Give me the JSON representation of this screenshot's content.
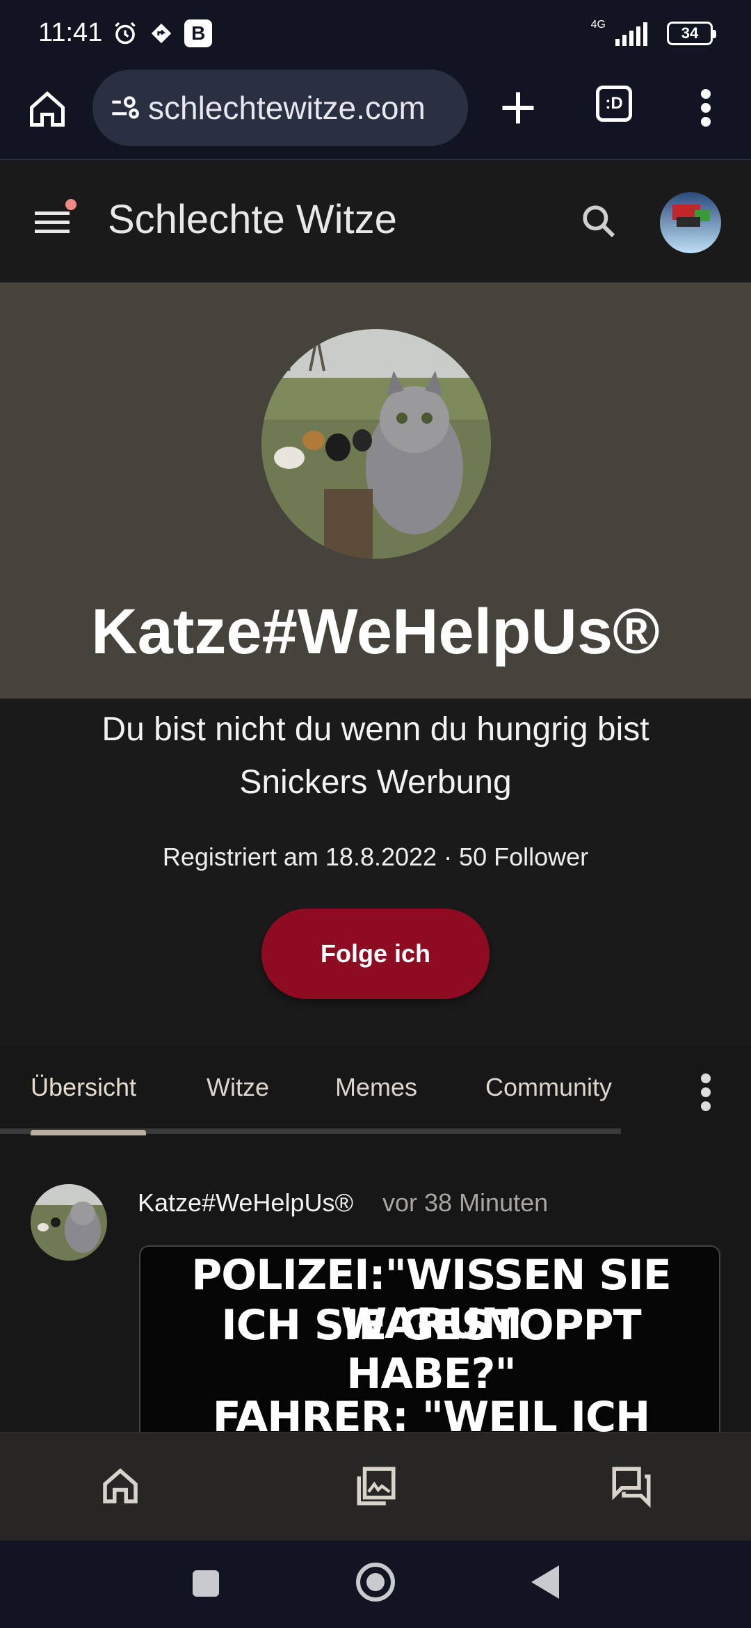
{
  "status_bar": {
    "time": "11:41",
    "network": "4G",
    "battery": "34",
    "b_badge": "B"
  },
  "browser": {
    "url": "schlechtewitze.com",
    "tabs_label": ":D"
  },
  "site": {
    "title": "Schlechte Witze"
  },
  "profile": {
    "name": "Katze#WeHelpUs®",
    "bio_line1": "Du bist nicht du wenn du hungrig bist",
    "bio_line2": "Snickers Werbung",
    "meta": "Registriert am 18.8.2022 · 50 Follower",
    "follow_label": "Folge ich"
  },
  "tabs": [
    {
      "label": "Übersicht"
    },
    {
      "label": "Witze"
    },
    {
      "label": "Memes"
    },
    {
      "label": "Community"
    }
  ],
  "post": {
    "author": "Katze#WeHelpUs®",
    "time": "vor 38 Minuten",
    "meme_line1": "POLIZEI:\"WISSEN SIE WARUM",
    "meme_line2": "ICH SIE GESTOPPT HABE?\"",
    "meme_line3": "FAHRER: \"WEIL ICH"
  },
  "colors": {
    "follow_button": "#8f0b22",
    "profile_bg": "#46423c",
    "browser_bg": "#111521"
  }
}
